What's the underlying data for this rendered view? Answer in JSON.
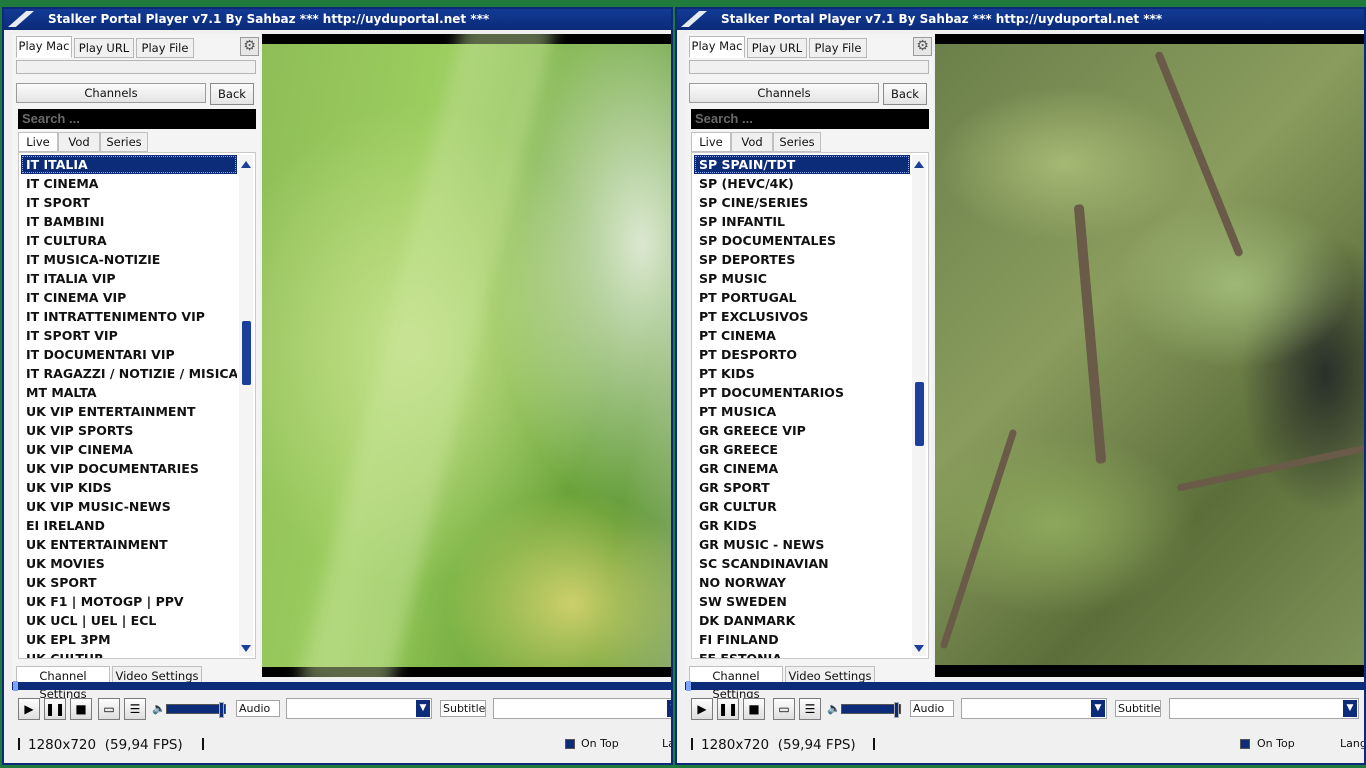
{
  "windows": [
    {
      "title": "Stalker Portal Player v7.1 By Sahbaz  *** http://uyduportal.net ***",
      "tabs": [
        "Play Mac",
        "Play URL",
        "Play File"
      ],
      "channels_label": "Channels",
      "back_label": "Back",
      "search_placeholder": "Search ...",
      "subtabs": [
        "Live",
        "Vod",
        "Series"
      ],
      "channels": [
        "IT ITALIA",
        "IT CINEMA",
        "IT SPORT",
        "IT BAMBINI",
        "IT CULTURA",
        "IT MUSICA-NOTIZIE",
        "IT ITALIA VIP",
        "IT CINEMA VIP",
        "IT INTRATTENIMENTO VIP",
        "IT SPORT VIP",
        "IT DOCUMENTARI VIP",
        "IT RAGAZZI / NOTIZIE / MISICA VIP",
        "MT MALTA",
        "UK VIP ENTERTAINMENT",
        "UK VIP SPORTS",
        "UK VIP CINEMA",
        "UK VIP DOCUMENTARIES",
        "UK VIP KIDS",
        "UK VIP MUSIC-NEWS",
        "EI IRELAND",
        "UK ENTERTAINMENT",
        "UK MOVIES",
        "UK SPORT",
        "UK F1 | MOTOGP | PPV",
        "UK UCL | UEL | ECL",
        "UK EPL 3PM",
        "UK CULTUR"
      ],
      "selected_index": 0,
      "scroll_position": 0.37,
      "bottom_tabs": [
        "Channel Settings",
        "Video Settings"
      ],
      "audio_label": "Audio",
      "subtitle_label": "Subtitle",
      "resolution": "1280x720",
      "fps": "(59,94 FPS)",
      "on_top_label": "On Top",
      "language_label": "Langu"
    },
    {
      "title": "Stalker Portal Player v7.1 By Sahbaz  *** http://uyduportal.net ***",
      "tabs": [
        "Play Mac",
        "Play URL",
        "Play File"
      ],
      "channels_label": "Channels",
      "back_label": "Back",
      "search_placeholder": "Search ...",
      "subtabs": [
        "Live",
        "Vod",
        "Series"
      ],
      "channels": [
        "SP SPAIN/TDT",
        "SP (HEVC/4K)",
        "SP CINE/SERIES",
        "SP INFANTIL",
        "SP DOCUMENTALES",
        "SP DEPORTES",
        "SP MUSIC",
        "PT PORTUGAL",
        "PT EXCLUSIVOS",
        "PT CINEMA",
        "PT DESPORTO",
        "PT KIDS",
        "PT DOCUMENTARIOS",
        "PT MUSICA",
        "GR GREECE VIP",
        "GR GREECE",
        "GR CINEMA",
        "GR SPORT",
        "GR CULTUR",
        "GR KIDS",
        "GR MUSIC - NEWS",
        "SC SCANDINAVIAN",
        "NO NORWAY",
        "SW SWEDEN",
        "DK DANMARK",
        "FI FINLAND",
        "EE ESTONIA"
      ],
      "selected_index": 0,
      "scroll_position": 0.52,
      "bottom_tabs": [
        "Channel Settings",
        "Video Settings"
      ],
      "audio_label": "Audio",
      "subtitle_label": "Subtitle",
      "resolution": "1280x720",
      "fps": "(59,94 FPS)",
      "on_top_label": "On Top",
      "language_label": "Langu"
    }
  ]
}
